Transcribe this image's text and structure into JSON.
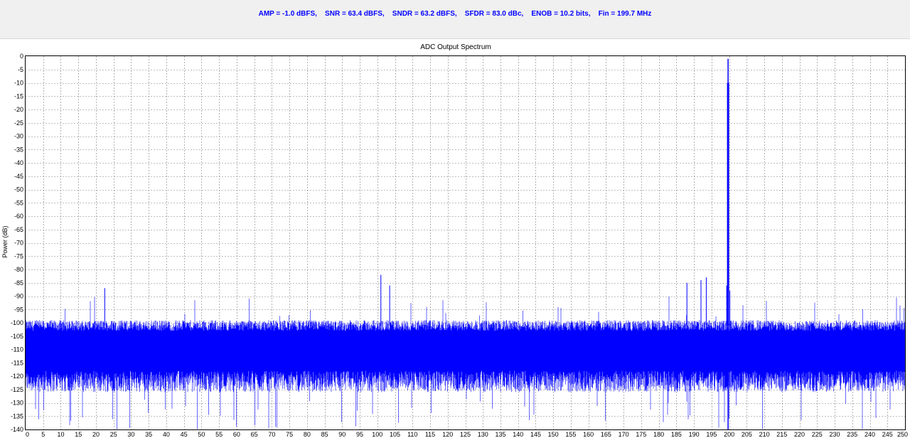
{
  "header": {
    "metrics_line": "AMP = -1.0 dBFS,    SNR = 63.4 dBFS,    SNDR = 63.2 dBFS,    SFDR = 83.0 dBc,    ENOB = 10.2 bits,    Fin = 199.7 MHz"
  },
  "colors": {
    "trace": "#0000ff",
    "metrics_text": "#0000ff",
    "grid": "#808080",
    "header_bg": "#f0f0f0"
  },
  "chart_data": {
    "type": "line",
    "title": "ADC Output Spectrum",
    "xlabel": "",
    "ylabel": "Power (dB)",
    "xlim": [
      0,
      250
    ],
    "ylim": [
      -140,
      0
    ],
    "x_ticks": [
      "0",
      "5",
      "10",
      "15",
      "20",
      "25",
      "30",
      "35",
      "40",
      "45",
      "50",
      "55",
      "60",
      "65",
      "70",
      "75",
      "80",
      "85",
      "90",
      "95",
      "100",
      "105",
      "110",
      "115",
      "120",
      "125",
      "130",
      "135",
      "140",
      "145",
      "150",
      "155",
      "160",
      "165",
      "170",
      "175",
      "180",
      "185",
      "190",
      "195",
      "200",
      "205",
      "210",
      "215",
      "220",
      "225",
      "230",
      "235",
      "240",
      "245",
      "250"
    ],
    "y_ticks": [
      "0",
      "-5",
      "-10",
      "-15",
      "-20",
      "-25",
      "-30",
      "-35",
      "-40",
      "-45",
      "-50",
      "-55",
      "-60",
      "-65",
      "-70",
      "-75",
      "-80",
      "-85",
      "-90",
      "-95",
      "-100",
      "-105",
      "-110",
      "-115",
      "-120",
      "-125",
      "-130",
      "-135",
      "-140"
    ],
    "grid": true,
    "legend": "none",
    "series": [
      {
        "noise_floor_mean_db": -110,
        "noise_band_db": [
          -122,
          -101
        ],
        "fundamental": {
          "x": 199.7,
          "y": -1.0
        },
        "spurs": [
          {
            "x": 22.5,
            "y": -87
          },
          {
            "x": 101,
            "y": -82
          },
          {
            "x": 103.5,
            "y": -86
          },
          {
            "x": 188,
            "y": -85
          },
          {
            "x": 192,
            "y": -84
          },
          {
            "x": 193.5,
            "y": -83
          },
          {
            "x": 199.3,
            "y": -86
          },
          {
            "x": 199.5,
            "y": -10
          },
          {
            "x": 199.9,
            "y": -10
          },
          {
            "x": 200.2,
            "y": -88
          }
        ]
      }
    ]
  }
}
